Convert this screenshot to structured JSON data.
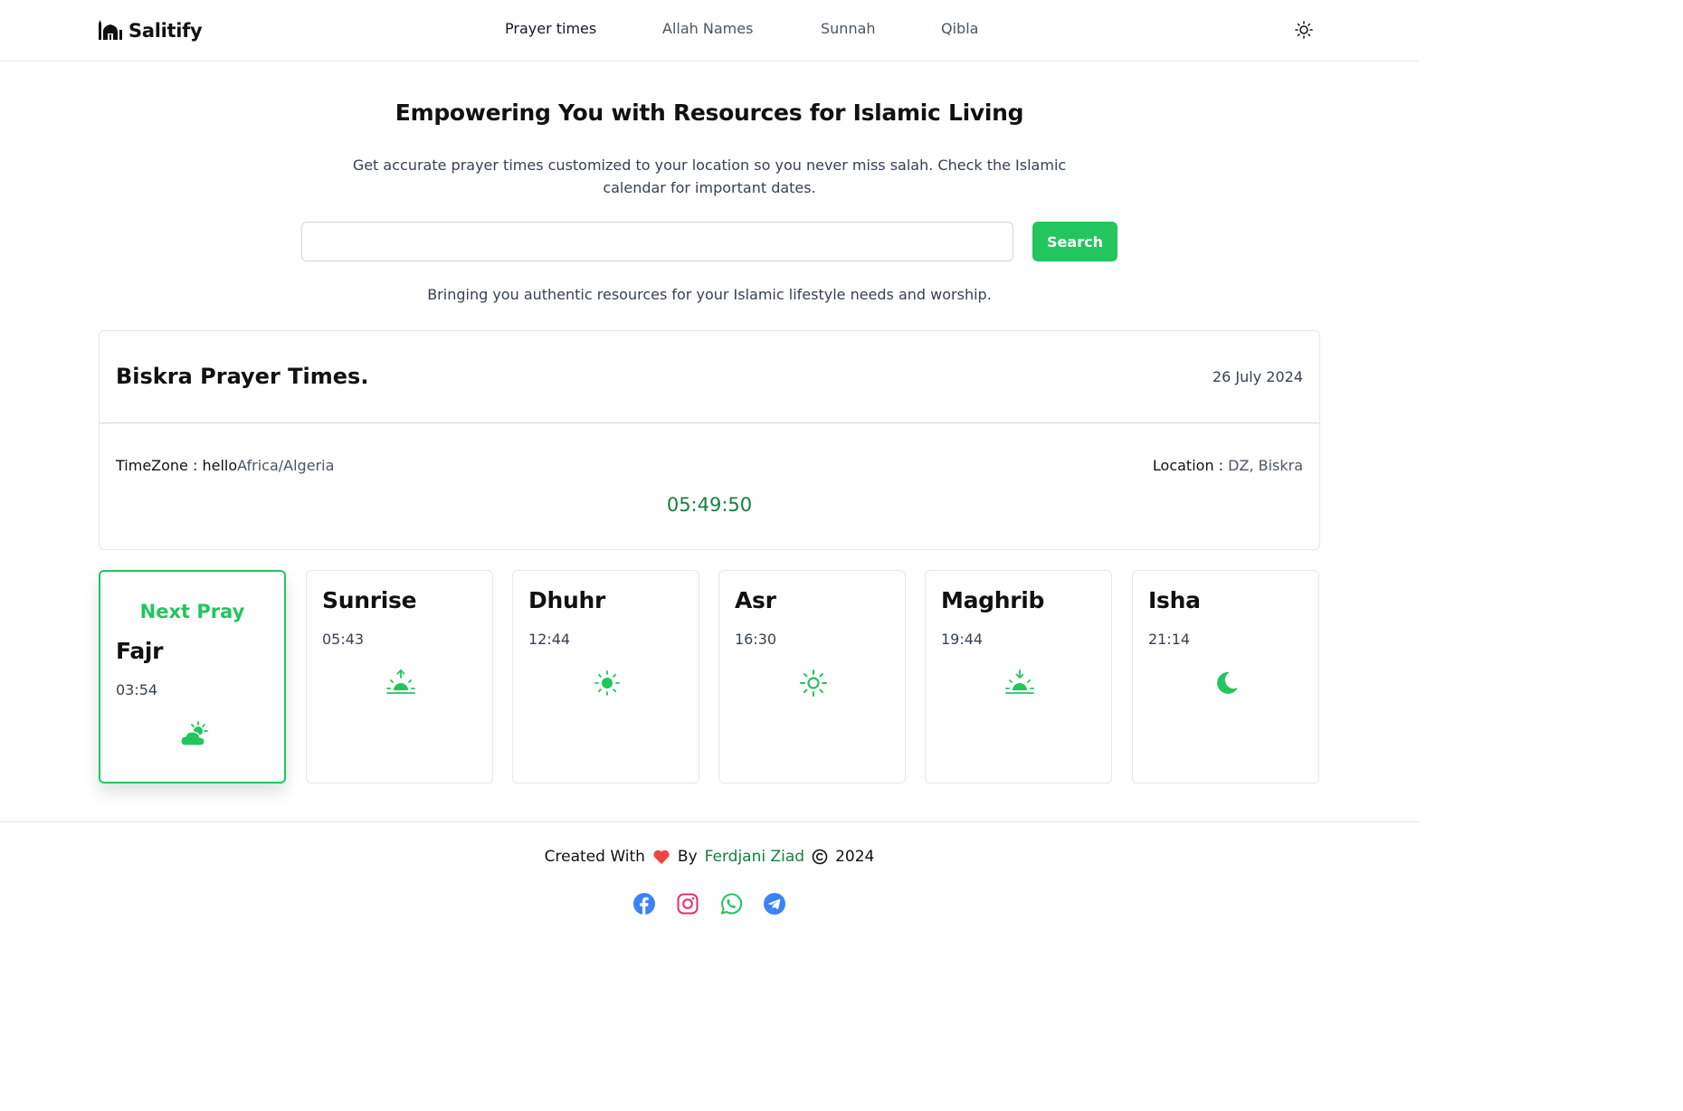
{
  "brand": {
    "name": "Salitify",
    "icon": "mosque-icon"
  },
  "nav": {
    "links": [
      "Prayer times",
      "Allah Names",
      "Sunnah",
      "Qibla"
    ],
    "active": "Prayer times",
    "theme_icon": "sun-icon"
  },
  "hero": {
    "title": "Empowering You with Resources for Islamic Living",
    "description": "Get accurate prayer times customized to your location so you never miss salah. Check the Islamic calendar for important dates."
  },
  "search": {
    "value": "",
    "placeholder": "",
    "button_label": "Search"
  },
  "tagline": "Bringing you authentic resources for your Islamic lifestyle needs and worship.",
  "info": {
    "city_title": "Biskra Prayer Times.",
    "date": "26 July 2024",
    "timezone_label": "TimeZone : hello",
    "timezone_value": "Africa/Algeria",
    "location_label": "Location : ",
    "location_value": "DZ, Biskra",
    "current_time": "05:49:50"
  },
  "prayers": [
    {
      "name": "Fajr",
      "time": "03:54",
      "icon": "cloud-sun-icon",
      "next": true,
      "next_label": "Next Pray"
    },
    {
      "name": "Sunrise",
      "time": "05:43",
      "icon": "sunrise-icon",
      "next": false
    },
    {
      "name": "Dhuhr",
      "time": "12:44",
      "icon": "sun-icon",
      "next": false
    },
    {
      "name": "Asr",
      "time": "16:30",
      "icon": "sun-outline-icon",
      "next": false
    },
    {
      "name": "Maghrib",
      "time": "19:44",
      "icon": "sunset-icon",
      "next": false
    },
    {
      "name": "Isha",
      "time": "21:14",
      "icon": "moon-icon",
      "next": false
    }
  ],
  "footer": {
    "created_with": "Created With",
    "by": "By",
    "author": "Ferdjani Ziad",
    "year": "2024",
    "socials": [
      "facebook-icon",
      "instagram-icon",
      "whatsapp-icon",
      "telegram-icon"
    ]
  },
  "colors": {
    "accent": "#22c55e",
    "accent_dark": "#15803d",
    "heart": "#ef4444"
  }
}
